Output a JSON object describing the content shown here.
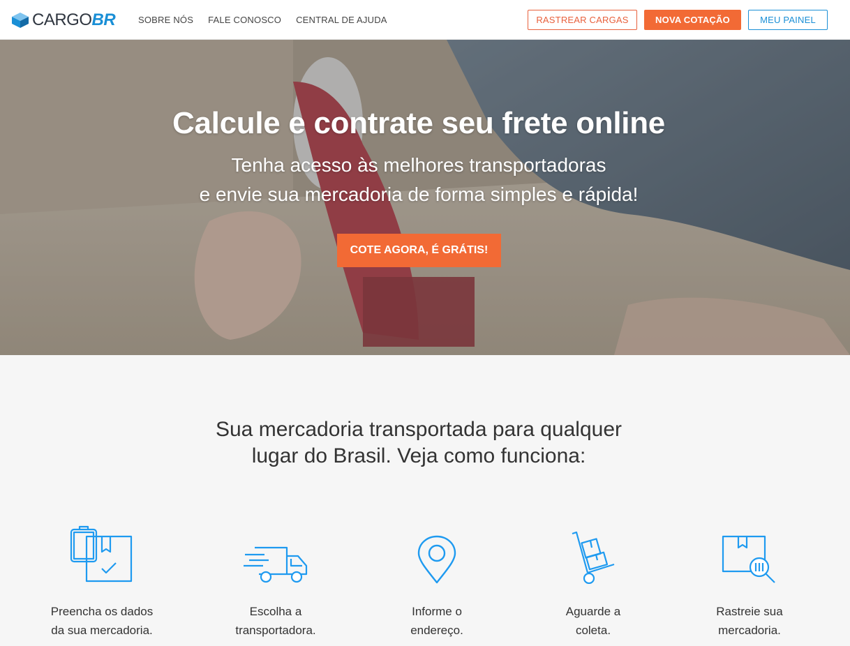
{
  "brand": {
    "name_part1": "CARGO",
    "name_part2": "BR"
  },
  "nav": {
    "links": [
      "SOBRE NÓS",
      "FALE CONOSCO",
      "CENTRAL DE AJUDA"
    ],
    "track_label": "RASTREAR CARGAS",
    "quote_label": "NOVA COTAÇÃO",
    "panel_label": "MEU PAINEL"
  },
  "hero": {
    "title": "Calcule e contrate seu frete online",
    "subtitle_line1": "Tenha acesso às melhores transportadoras",
    "subtitle_line2": "e envie sua mercadoria de forma simples e rápida!",
    "cta_label": "COTE AGORA, É GRÁTIS!"
  },
  "how": {
    "title_line1": "Sua mercadoria transportada para qualquer",
    "title_line2": "lugar do Brasil. Veja como funciona:",
    "steps": [
      {
        "icon": "clipboard-box-icon",
        "line1": "Preencha os dados",
        "line2": "da sua mercadoria."
      },
      {
        "icon": "truck-icon",
        "line1": "Escolha a",
        "line2": "transportadora."
      },
      {
        "icon": "map-pin-icon",
        "line1": "Informe o",
        "line2": "endereço."
      },
      {
        "icon": "hand-truck-icon",
        "line1": "Aguarde a",
        "line2": "coleta."
      },
      {
        "icon": "box-search-icon",
        "line1": "Rastreie sua",
        "line2": "mercadoria."
      }
    ]
  },
  "colors": {
    "accent_orange": "#f26a35",
    "accent_blue": "#1a8fd6",
    "icon_blue": "#1e9af0"
  }
}
